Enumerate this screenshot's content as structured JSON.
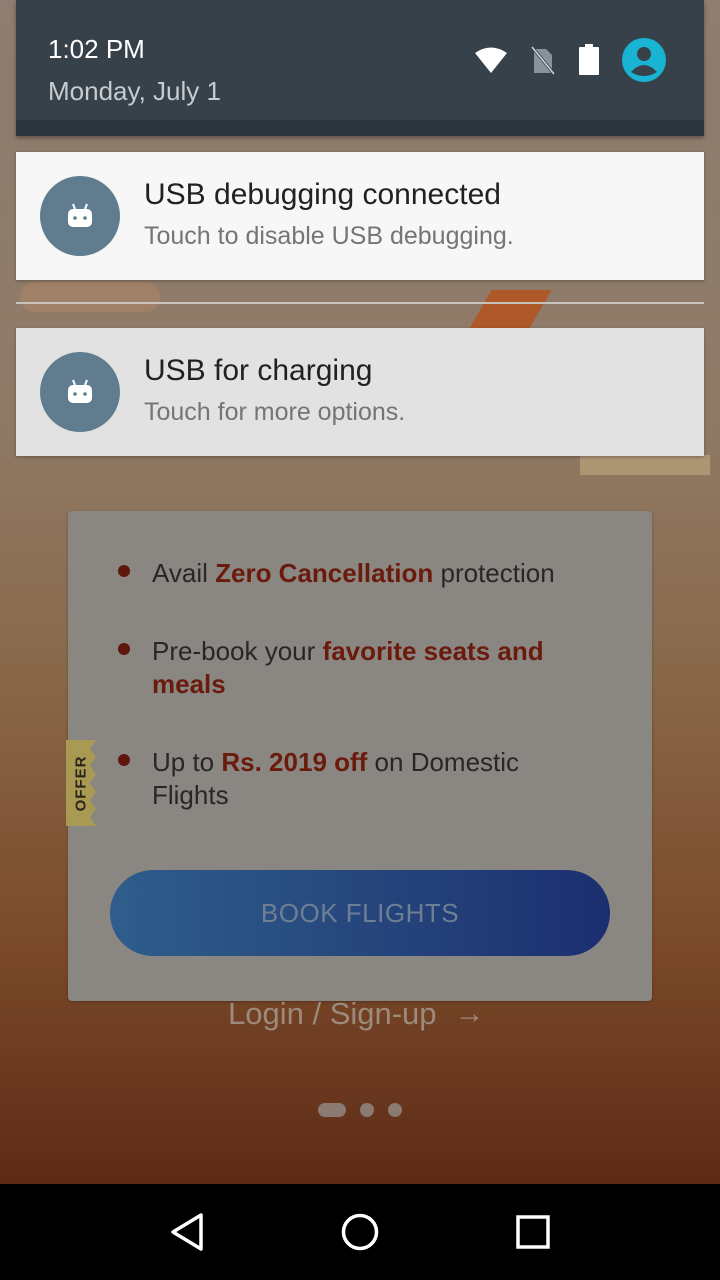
{
  "status_bar": {
    "time": "1:02 PM",
    "date": "Monday, July 1",
    "icons": [
      "wifi-icon",
      "no-sim-icon",
      "battery-icon",
      "user-account-icon"
    ]
  },
  "notifications": [
    {
      "title": "USB debugging connected",
      "subtitle": "Touch to disable USB debugging.",
      "icon": "android-icon"
    },
    {
      "title": "USB for charging",
      "subtitle": "Touch for more options.",
      "icon": "android-icon"
    }
  ],
  "app": {
    "offer_tag": "OFFER",
    "bullets": [
      {
        "pre": "Avail ",
        "highlight": "Zero Cancellation",
        "post": " protection"
      },
      {
        "pre": "Pre-book your ",
        "highlight": "favorite seats and meals",
        "post": ""
      },
      {
        "pre": "Up to ",
        "highlight": "Rs. 2019 off",
        "post": " on Domestic Flights"
      }
    ],
    "book_button": "BOOK FLIGHTS",
    "login_link": "Login / Sign-up",
    "login_arrow": "→"
  },
  "colors": {
    "shade_header": "#37414a",
    "notif_icon_bg": "#5f7d8e",
    "highlight_text": "#6a1b0c",
    "button_gradient_start": "#2f5d8c",
    "button_gradient_end": "#1b2f70"
  },
  "navbar": {
    "buttons": [
      "back-icon",
      "home-icon",
      "recents-icon"
    ]
  }
}
